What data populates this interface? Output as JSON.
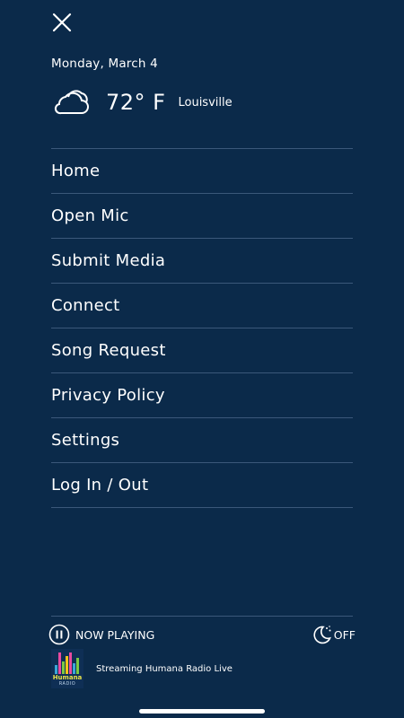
{
  "header": {
    "date": "Monday, March 4",
    "temperature": "72° F",
    "city": "Louisville"
  },
  "menu": {
    "items": [
      {
        "label": "Home"
      },
      {
        "label": "Open Mic"
      },
      {
        "label": "Submit Media"
      },
      {
        "label": "Connect"
      },
      {
        "label": "Song Request"
      },
      {
        "label": "Privacy Policy"
      },
      {
        "label": "Settings"
      },
      {
        "label": "Log In / Out"
      }
    ]
  },
  "player": {
    "now_playing_label": "NOW PLAYING",
    "sleep_timer_label": "OFF",
    "station_title": "Streaming Humana Radio Live",
    "logo_text": "Humana",
    "logo_subtext": "RADIO"
  },
  "colors": {
    "background": "#0b2a4a",
    "divider": "#3b587a",
    "text": "#ffffff"
  },
  "icons": {
    "close": "close-icon",
    "weather": "cloudy-icon",
    "play_state": "pause-icon",
    "sleep": "moon-icon"
  }
}
